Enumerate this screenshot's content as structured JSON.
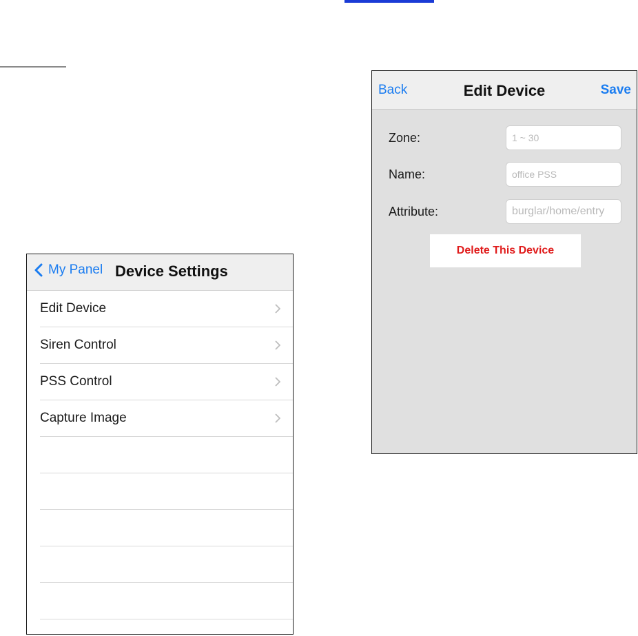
{
  "device_settings": {
    "back_label": "My Panel",
    "title": "Device Settings",
    "items": [
      {
        "label": "Edit Device"
      },
      {
        "label": "Siren Control"
      },
      {
        "label": "PSS Control"
      },
      {
        "label": "Capture Image"
      }
    ]
  },
  "edit_device": {
    "back_label": "Back",
    "title": "Edit Device",
    "save_label": "Save",
    "fields": {
      "zone": {
        "label": "Zone:",
        "placeholder": "1 ~ 30"
      },
      "name": {
        "label": "Name:",
        "placeholder": "office PSS"
      },
      "attribute": {
        "label": "Attribute:",
        "placeholder": "burglar/home/entry"
      }
    },
    "delete_label": "Delete This Device"
  },
  "colors": {
    "accent": "#1a7cf0",
    "destructive": "#e01b1b",
    "nav_bar": "#efefef",
    "form_background": "#e0e0e0"
  },
  "icons": [
    "chevron-left-icon",
    "chevron-right-icon"
  ]
}
